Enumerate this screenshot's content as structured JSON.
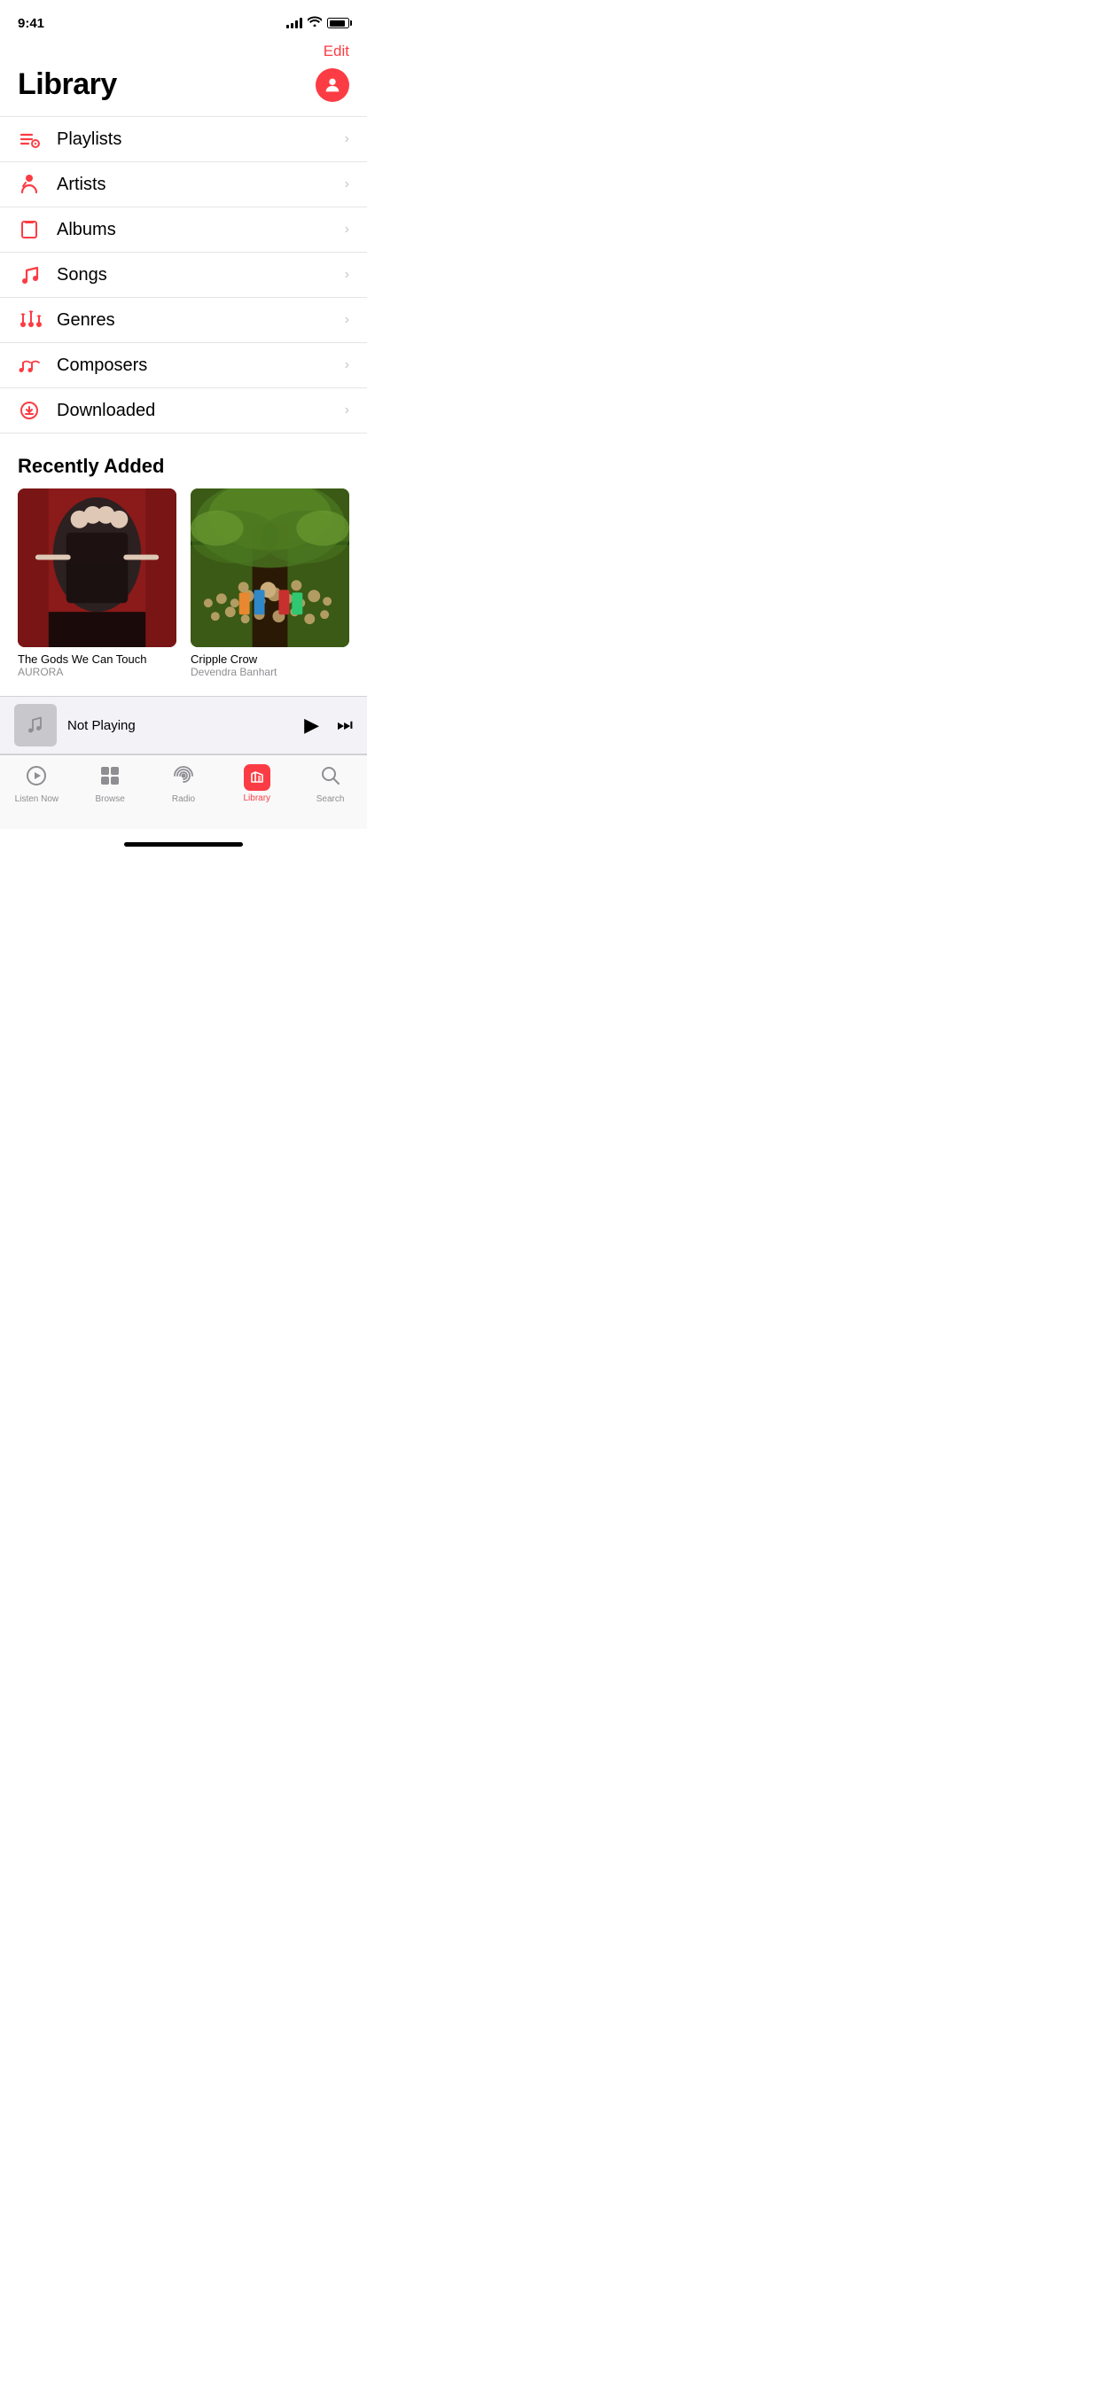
{
  "statusBar": {
    "time": "9:41"
  },
  "header": {
    "editLabel": "Edit"
  },
  "title": {
    "pageTitle": "Library"
  },
  "menu": {
    "items": [
      {
        "id": "playlists",
        "label": "Playlists",
        "icon": "playlist-icon"
      },
      {
        "id": "artists",
        "label": "Artists",
        "icon": "artist-icon"
      },
      {
        "id": "albums",
        "label": "Albums",
        "icon": "album-icon"
      },
      {
        "id": "songs",
        "label": "Songs",
        "icon": "song-icon"
      },
      {
        "id": "genres",
        "label": "Genres",
        "icon": "genre-icon"
      },
      {
        "id": "composers",
        "label": "Composers",
        "icon": "composer-icon"
      },
      {
        "id": "downloaded",
        "label": "Downloaded",
        "icon": "download-icon"
      }
    ]
  },
  "recentlyAdded": {
    "sectionTitle": "Recently Added",
    "albums": [
      {
        "id": "aurora",
        "name": "The Gods We Can Touch",
        "artist": "AURORA",
        "coverType": "aurora"
      },
      {
        "id": "devendra",
        "name": "Cripple Crow",
        "artist": "Devendra Banhart",
        "coverType": "devendra"
      }
    ]
  },
  "miniPlayer": {
    "notPlayingLabel": "Not Playing"
  },
  "tabBar": {
    "tabs": [
      {
        "id": "listen-now",
        "label": "Listen Now",
        "icon": "play-circle-icon",
        "active": false
      },
      {
        "id": "browse",
        "label": "Browse",
        "icon": "browse-icon",
        "active": false
      },
      {
        "id": "radio",
        "label": "Radio",
        "icon": "radio-icon",
        "active": false
      },
      {
        "id": "library",
        "label": "Library",
        "icon": "library-icon",
        "active": true
      },
      {
        "id": "search",
        "label": "Search",
        "icon": "search-icon",
        "active": false
      }
    ]
  }
}
